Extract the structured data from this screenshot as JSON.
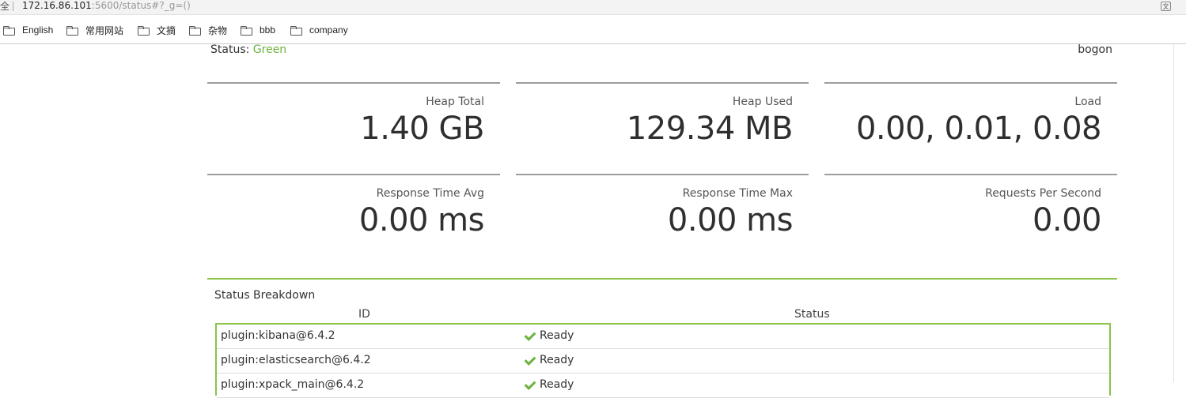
{
  "browser": {
    "lead_char": "全",
    "url_host": "172.16.86.101",
    "url_rest": ":5600/status#?_g=()",
    "translate_icon": "translate-icon"
  },
  "bookmarks": [
    {
      "label": "English",
      "icon": "folder-icon"
    },
    {
      "label": "常用网站",
      "icon": "folder-icon"
    },
    {
      "label": "文摘",
      "icon": "folder-icon"
    },
    {
      "label": "杂物",
      "icon": "folder-icon"
    },
    {
      "label": "bbb",
      "icon": "folder-icon"
    },
    {
      "label": "company",
      "icon": "folder-icon"
    }
  ],
  "status": {
    "label": "Status:",
    "value": "Green",
    "color": "#6cb33f",
    "hostname": "bogon"
  },
  "metrics": [
    {
      "label": "Heap Total",
      "value": "1.40 GB"
    },
    {
      "label": "Heap Used",
      "value": "129.34 MB"
    },
    {
      "label": "Load",
      "value": "0.00, 0.01, 0.08"
    },
    {
      "label": "Response Time Avg",
      "value": "0.00 ms"
    },
    {
      "label": "Response Time Max",
      "value": "0.00 ms"
    },
    {
      "label": "Requests Per Second",
      "value": "0.00"
    }
  ],
  "breakdown": {
    "title": "Status Breakdown",
    "columns": {
      "id": "ID",
      "status": "Status"
    },
    "rows": [
      {
        "id": "plugin:kibana@6.4.2",
        "status": "Ready"
      },
      {
        "id": "plugin:elasticsearch@6.4.2",
        "status": "Ready"
      },
      {
        "id": "plugin:xpack_main@6.4.2",
        "status": "Ready"
      }
    ]
  }
}
